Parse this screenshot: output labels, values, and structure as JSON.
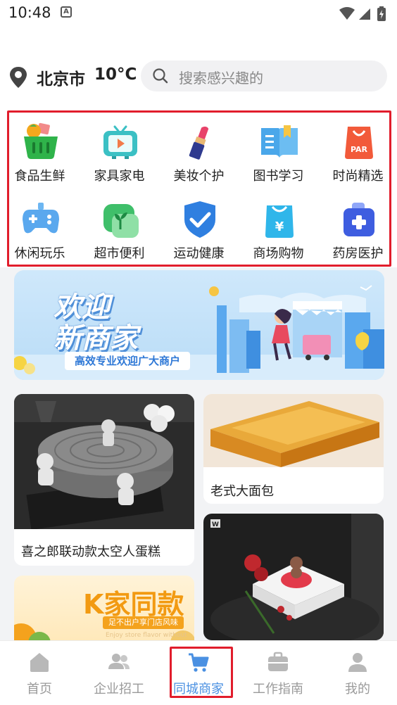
{
  "status_bar": {
    "time": "10:48",
    "notif_icon": "a-icon",
    "icons": [
      "wifi-icon",
      "signal-icon",
      "battery-charging-icon"
    ]
  },
  "header": {
    "city": "北京市",
    "temperature": "10°C",
    "search_placeholder": "搜索感兴趣的"
  },
  "categories": [
    {
      "label": "食品生鲜",
      "icon": "grocery-basket-icon"
    },
    {
      "label": "家具家电",
      "icon": "tv-icon"
    },
    {
      "label": "美妆个护",
      "icon": "lipstick-icon"
    },
    {
      "label": "图书学习",
      "icon": "book-icon"
    },
    {
      "label": "时尚精选",
      "icon": "fashion-bag-icon"
    },
    {
      "label": "休闲玩乐",
      "icon": "gamepad-icon"
    },
    {
      "label": "超市便利",
      "icon": "sprout-icon"
    },
    {
      "label": "运动健康",
      "icon": "shield-check-icon"
    },
    {
      "label": "商场购物",
      "icon": "shopping-bag-yen-icon"
    },
    {
      "label": "药房医护",
      "icon": "medical-kit-icon"
    }
  ],
  "banner": {
    "line1": "欢迎",
    "line2": "新商家",
    "subtitle": "高效专业欢迎广大商户"
  },
  "products": [
    {
      "title": "喜之郎联动款太空人蛋糕"
    },
    {
      "title": "老式大面包"
    },
    {
      "title": "K家同款",
      "tagline": "足不出户享门店风味",
      "tagline_en": "Enjoy store flavor without"
    }
  ],
  "tabs": [
    {
      "label": "首页",
      "icon": "home-icon",
      "active": false
    },
    {
      "label": "企业招工",
      "icon": "users-icon",
      "active": false
    },
    {
      "label": "同城商家",
      "icon": "shopping-cart-icon",
      "active": true
    },
    {
      "label": "工作指南",
      "icon": "briefcase-icon",
      "active": false
    },
    {
      "label": "我的",
      "icon": "profile-icon",
      "active": false
    }
  ],
  "colors": {
    "accent": "#4a90e2",
    "highlight_frame": "#e11d2c",
    "banner_blue": "#4f8fd8"
  }
}
